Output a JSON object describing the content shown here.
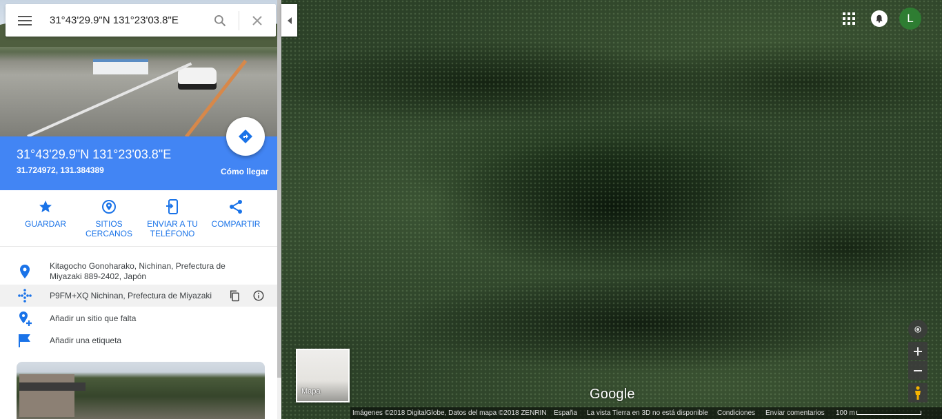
{
  "search": {
    "value": "31°43'29.9\"N 131°23'03.8\"E",
    "menu_icon": "menu-icon",
    "search_icon": "search-icon",
    "clear_icon": "close-icon"
  },
  "place": {
    "title": "31°43'29.9\"N 131°23'03.8\"E",
    "coords": "31.724972, 131.384389",
    "directions_label": "Cómo llegar",
    "directions_icon": "directions-icon"
  },
  "actions": [
    {
      "label": "GUARDAR",
      "icon": "star-icon"
    },
    {
      "label": "SITIOS CERCANOS",
      "icon": "nearby-icon"
    },
    {
      "label": "ENVIAR A TU TELÉFONO",
      "icon": "send-to-phone-icon"
    },
    {
      "label": "COMPARTIR",
      "icon": "share-icon"
    }
  ],
  "info": {
    "address": "Kitagocho Gonoharako, Nichinan, Prefectura de Miyazaki 889-2402, Japón",
    "pluscode": "P9FM+XQ Nichinan, Prefectura de Miyazaki",
    "add_missing": "Añadir un sitio que falta",
    "add_label": "Añadir una etiqueta"
  },
  "map": {
    "minimap_label": "Mapa",
    "logo": "Google",
    "avatar_letter": "L"
  },
  "footer": {
    "imagery": "Imágenes ©2018 DigitalGlobe, Datos del mapa ©2018 ZENRIN",
    "country": "España",
    "notice": "La vista Tierra en 3D no está disponible",
    "terms": "Condiciones",
    "feedback": "Enviar comentarios",
    "scale": "100 m"
  },
  "colors": {
    "accent": "#4285f4",
    "action_blue": "#1a73e8",
    "avatar": "#2e7d32"
  }
}
